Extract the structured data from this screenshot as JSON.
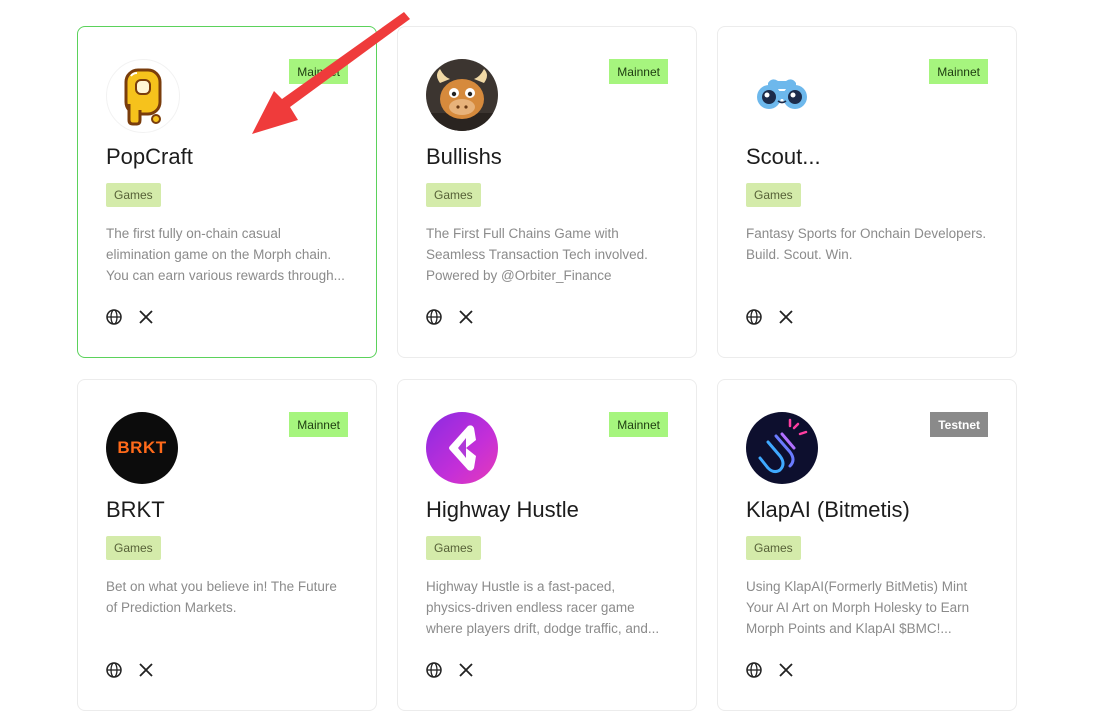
{
  "cards": [
    {
      "title": "PopCraft",
      "network": "Mainnet",
      "category": "Games",
      "description": [
        "The first fully on-chain casual",
        "elimination game on the Morph chain.",
        "You can earn various rewards through..."
      ],
      "logo": "popcraft-logo"
    },
    {
      "title": "Bullishs",
      "network": "Mainnet",
      "category": "Games",
      "description": [
        "The First Full Chains Game with",
        "Seamless Transaction Tech involved.",
        "Powered by @Orbiter_Finance"
      ],
      "logo": "bull-logo"
    },
    {
      "title": "Scout...",
      "network": "Mainnet",
      "category": "Games",
      "description": [
        "Fantasy Sports for Onchain Developers.",
        "Build. Scout. Win."
      ],
      "logo": "binoculars-logo"
    },
    {
      "title": "BRKT",
      "network": "Mainnet",
      "category": "Games",
      "description": [
        "Bet on what you believe in! The Future",
        "of Prediction Markets."
      ],
      "logo": "brkt-logo",
      "logo_text": "BRKT"
    },
    {
      "title": "Highway Hustle",
      "network": "Mainnet",
      "category": "Games",
      "description": [
        "Highway Hustle is a fast-paced,",
        "physics-driven endless racer game",
        "where players drift, dodge traffic, and..."
      ],
      "logo": "highway-hustle-logo"
    },
    {
      "title": "KlapAI (Bitmetis)",
      "network": "Testnet",
      "category": "Games",
      "description": [
        "Using KlapAI(Formerly BitMetis) Mint",
        "Your AI Art on Morph Holesky to Earn",
        "Morph Points and KlapAI $BMC!..."
      ],
      "logo": "clapping-hands-logo"
    }
  ],
  "icons": {
    "website": "globe-icon",
    "social": "x-icon"
  },
  "colors": {
    "mainnet_badge": "#a6f57e",
    "testnet_badge": "#8a8a8a",
    "category_tag": "#d4ebaa",
    "active_border": "#5bd25b",
    "annotation_arrow": "#ef3b3b"
  }
}
